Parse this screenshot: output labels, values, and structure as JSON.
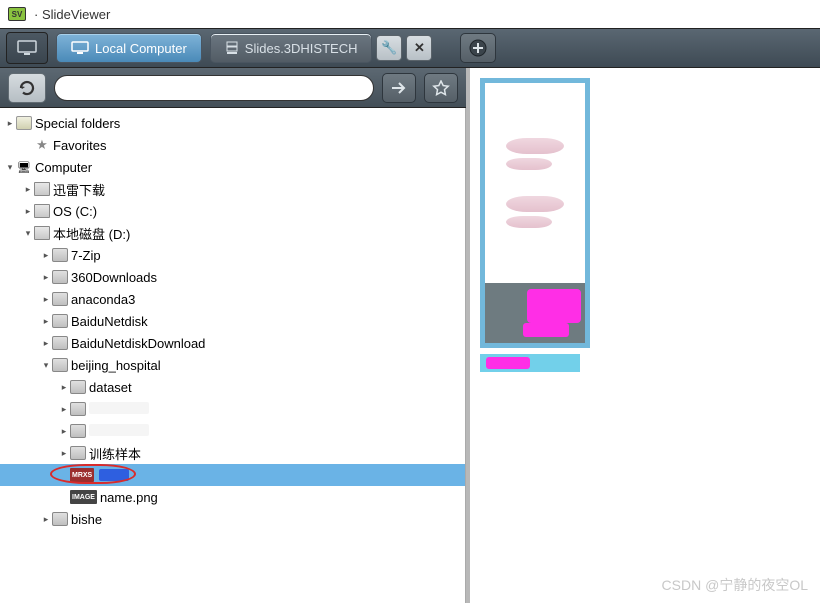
{
  "window": {
    "title": "· SlideViewer"
  },
  "toolbar": {
    "tabs": [
      {
        "label": "Local Computer",
        "active": true
      },
      {
        "label": "Slides.3DHISTECH",
        "active": false
      }
    ]
  },
  "pathbar": {
    "path_value": ""
  },
  "tree": {
    "nodes": [
      {
        "depth": 0,
        "caret": "closed",
        "icon": "folder-o",
        "label": "Special folders"
      },
      {
        "depth": 1,
        "caret": "none",
        "icon": "star",
        "label": "Favorites"
      },
      {
        "depth": 0,
        "caret": "open",
        "icon": "computer",
        "label": "Computer"
      },
      {
        "depth": 1,
        "caret": "closed",
        "icon": "drive",
        "label": "迅雷下载"
      },
      {
        "depth": 1,
        "caret": "closed",
        "icon": "drive",
        "label": "OS (C:)"
      },
      {
        "depth": 1,
        "caret": "open",
        "icon": "drive",
        "label": "本地磁盘 (D:)"
      },
      {
        "depth": 2,
        "caret": "closed",
        "icon": "folder",
        "label": "7-Zip"
      },
      {
        "depth": 2,
        "caret": "closed",
        "icon": "folder",
        "label": "360Downloads"
      },
      {
        "depth": 2,
        "caret": "closed",
        "icon": "folder",
        "label": "anaconda3"
      },
      {
        "depth": 2,
        "caret": "closed",
        "icon": "folder",
        "label": "BaiduNetdisk"
      },
      {
        "depth": 2,
        "caret": "closed",
        "icon": "folder",
        "label": "BaiduNetdiskDownload"
      },
      {
        "depth": 2,
        "caret": "open",
        "icon": "folder",
        "label": "beijing_hospital"
      },
      {
        "depth": 3,
        "caret": "closed",
        "icon": "folder",
        "label": "dataset"
      },
      {
        "depth": 3,
        "caret": "closed",
        "icon": "folder",
        "label": "",
        "redacted": true
      },
      {
        "depth": 3,
        "caret": "closed",
        "icon": "folder",
        "label": "",
        "redacted": true
      },
      {
        "depth": 3,
        "caret": "closed",
        "icon": "folder",
        "label": "训练样本"
      },
      {
        "depth": 3,
        "caret": "none",
        "icon": "badge mrxs",
        "badge": "MRXS",
        "label": "",
        "selected": true,
        "blue": true,
        "circled": true
      },
      {
        "depth": 3,
        "caret": "none",
        "icon": "badge image",
        "badge": "IMAGE",
        "label": "name.png"
      },
      {
        "depth": 2,
        "caret": "closed",
        "icon": "folder",
        "label": "bishe",
        "cut": true
      }
    ]
  },
  "watermark": "CSDN @宁静的夜空OL"
}
